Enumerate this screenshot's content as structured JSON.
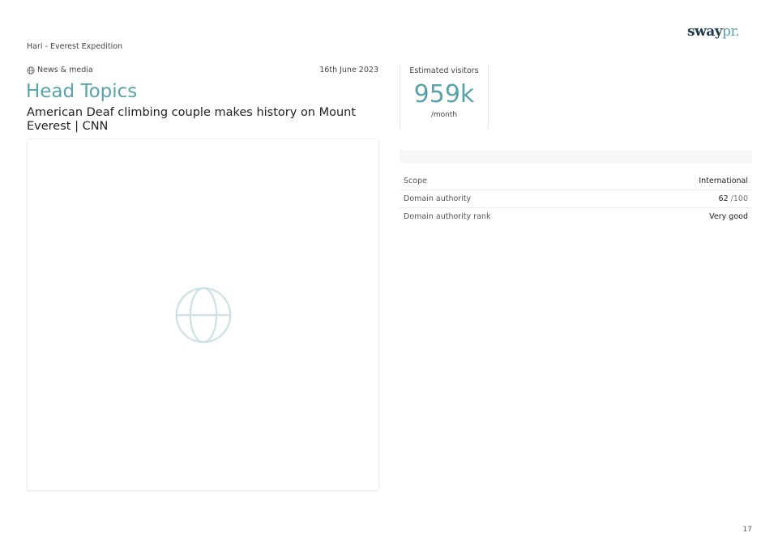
{
  "brand": {
    "logo_part1": "sway",
    "logo_part2": "pr."
  },
  "report_title": "Hari - Everest Expedition",
  "article": {
    "category": "News & media",
    "date": "16th June 2023",
    "outlet": "Head Topics",
    "headline": "American Deaf climbing couple makes history on Mount Everest | CNN",
    "preview_icon": "globe-icon"
  },
  "visitors": {
    "label": "Estimated visitors",
    "value": "959k",
    "unit": "/month"
  },
  "metrics": [
    {
      "label": "Scope",
      "value": "International",
      "suffix": ""
    },
    {
      "label": "Domain authority",
      "value": "62",
      "suffix": " /100"
    },
    {
      "label": "Domain authority rank",
      "value": "Very good",
      "suffix": ""
    }
  ],
  "page_number": "17",
  "colors": {
    "accent": "#5aa3ad",
    "logo_dark": "#1f3a4d",
    "icon_light": "#cfe3e6"
  }
}
